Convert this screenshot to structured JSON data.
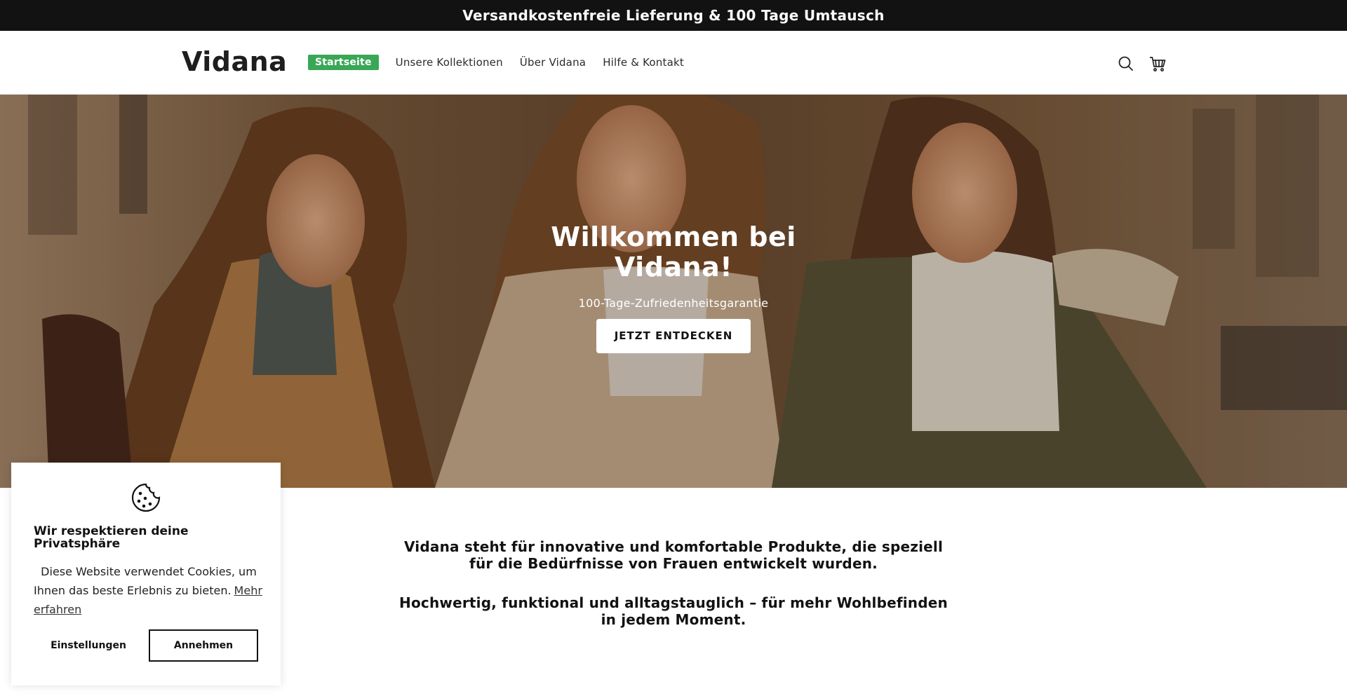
{
  "announcement": {
    "text": "Versandkostenfreie Lieferung & 100 Tage Umtausch"
  },
  "header": {
    "logo": "Vidana",
    "nav": [
      {
        "label": "Startseite",
        "active": true
      },
      {
        "label": "Unsere Kollektionen"
      },
      {
        "label": "Über Vidana"
      },
      {
        "label": "Hilfe & Kontakt"
      }
    ],
    "icons": [
      "search-icon",
      "cart-icon"
    ]
  },
  "hero": {
    "title": "Willkommen bei Vidana!",
    "subtitle": "100-Tage-Zufriedenheitsgarantie",
    "button": "JETZT ENTDECKEN"
  },
  "intro": {
    "paragraph1": "Vidana steht für innovative und komfortable Produkte, die speziell für die Bedürfnisse von Frauen entwickelt wurden.",
    "paragraph2": "Hochwertig, funktional und alltagstauglich – für mehr Wohlbefinden in jedem Moment."
  },
  "cookie_banner": {
    "icon": "cookie-icon",
    "title": "Wir respektieren deine Privatsphäre",
    "text": "Diese Website verwendet Cookies, um Ihnen das beste Erlebnis zu bieten.",
    "link": "Mehr erfahren",
    "settings_button": "Einstellungen",
    "accept_button": "Annehmen"
  },
  "colors": {
    "announcement_bg": "#121212",
    "active_nav_bg": "#3aa757",
    "text": "#121212"
  }
}
